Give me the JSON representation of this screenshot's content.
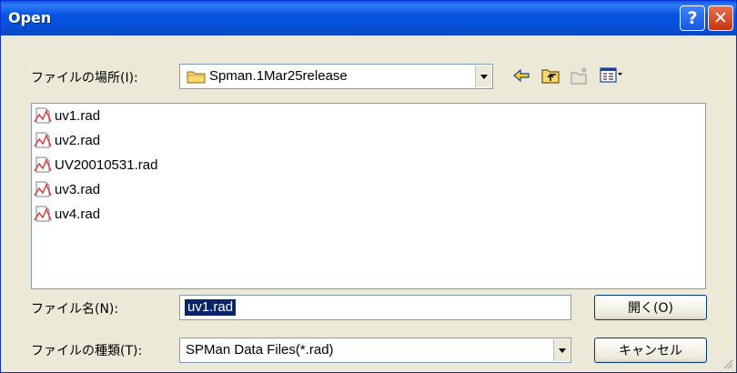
{
  "window": {
    "title": "Open",
    "help_glyph": "?",
    "close_glyph": "✕"
  },
  "location": {
    "label": "ファイルの場所(I):",
    "folder": "Spman.1Mar25release"
  },
  "toolbar": {
    "icons": [
      "back-arrow-icon",
      "up-folder-icon",
      "new-folder-icon",
      "view-menu-icon"
    ]
  },
  "files": [
    {
      "name": "uv1.rad",
      "icon": "rad-file-icon"
    },
    {
      "name": "uv2.rad",
      "icon": "rad-file-icon"
    },
    {
      "name": "UV20010531.rad",
      "icon": "rad-file-icon"
    },
    {
      "name": "uv3.rad",
      "icon": "rad-file-icon"
    },
    {
      "name": "uv4.rad",
      "icon": "rad-file-icon"
    }
  ],
  "filename": {
    "label": "ファイル名(N):",
    "value": "uv1.rad"
  },
  "filetype": {
    "label": "ファイルの種類(T):",
    "value": "SPMan Data Files(*.rad)"
  },
  "buttons": {
    "open": "開く(O)",
    "cancel": "キャンセル"
  },
  "colors": {
    "titlebar": "#0754e3",
    "dialog_bg": "#ece9d8",
    "selection": "#0a246a",
    "folder": "#f5d96b"
  }
}
